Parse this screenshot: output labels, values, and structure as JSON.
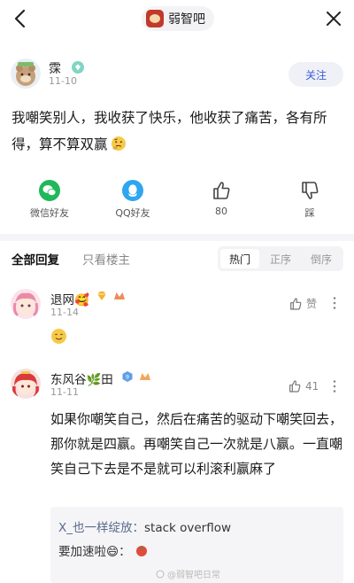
{
  "topbar": {
    "forum_name": "弱智吧",
    "back_icon": "chevron-left-icon",
    "more_icon": "close-icon"
  },
  "post": {
    "author": "霂",
    "date": "11-10",
    "follow_label": "关注",
    "text": "我嘲笑别人，我收获了快乐，他收获了痛苦，各有所得，算不算双赢",
    "emoji": "thinking-face"
  },
  "share": [
    {
      "label": "微信好友",
      "icon": "wechat-icon",
      "color": "#21b85a"
    },
    {
      "label": "QQ好友",
      "icon": "qq-icon",
      "color": "#2ea6f0"
    },
    {
      "label": "80",
      "icon": "thumbs-up-icon",
      "color": "#444444"
    },
    {
      "label": "踩",
      "icon": "thumbs-down-icon",
      "color": "#444444"
    }
  ],
  "tabs": {
    "all": "全部回复",
    "op_only": "只看楼主",
    "sort": [
      "热门",
      "正序",
      "倒序"
    ],
    "sort_active": "热门"
  },
  "comments": [
    {
      "name": "退网🥰",
      "date": "11-14",
      "like_label": "赞",
      "body_emoji": "smiling-face"
    },
    {
      "name": "东风谷🌿田",
      "date": "11-11",
      "like_label": "41",
      "text": "如果你嘲笑自己，然后在痛苦的驱动下嘲笑回去，那你就是四赢。再嘲笑自己一次就是八赢。一直嘲笑自己下去是不是就可以利滚利赢麻了",
      "replies": [
        {
          "user": "X_也一样绽放：",
          "text": "stack overflow"
        },
        {
          "user": "要加速啦😄：",
          "text": ""
        }
      ]
    }
  ],
  "watermark": "@弱智吧日常",
  "colors": {
    "accent": "#3b5cd8",
    "wechat": "#21b85a",
    "qq": "#2ea6f0"
  }
}
